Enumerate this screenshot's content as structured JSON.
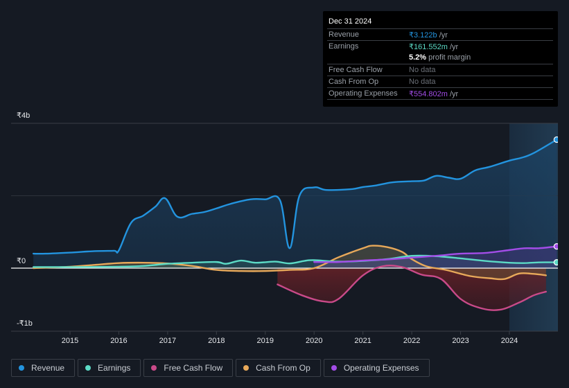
{
  "tooltip": {
    "date": "Dec 31 2024",
    "rows": [
      {
        "label": "Revenue",
        "value": "₹3.122b",
        "suffix": " /yr",
        "color": "#2394df"
      },
      {
        "label": "Earnings",
        "value": "₹161.552m",
        "suffix": " /yr",
        "color": "#5cdbc6"
      },
      {
        "label": "",
        "value": "5.2%",
        "suffix": " profit margin",
        "color": "#ffffff"
      },
      {
        "label": "Free Cash Flow",
        "value": "No data",
        "suffix": "",
        "color": "#6b7078"
      },
      {
        "label": "Cash From Op",
        "value": "No data",
        "suffix": "",
        "color": "#6b7078"
      },
      {
        "label": "Operating Expenses",
        "value": "₹554.802m",
        "suffix": " /yr",
        "color": "#a34de8"
      }
    ]
  },
  "legend": [
    {
      "label": "Revenue",
      "color": "#2394df"
    },
    {
      "label": "Earnings",
      "color": "#5cdbc6"
    },
    {
      "label": "Free Cash Flow",
      "color": "#c94a89"
    },
    {
      "label": "Cash From Op",
      "color": "#e8a95a"
    },
    {
      "label": "Operating Expenses",
      "color": "#a34de8"
    }
  ],
  "chart_data": {
    "type": "line",
    "title": "",
    "xlabel": "",
    "ylabel": "",
    "y_ticks": [
      "₹4b",
      "₹0",
      "-₹1b"
    ],
    "y_tick_values": [
      4,
      0,
      -1
    ],
    "ylim": [
      -1,
      4
    ],
    "xlim": [
      2014.2,
      2025.0
    ],
    "x_ticks": [
      "2015",
      "2016",
      "2017",
      "2018",
      "2019",
      "2020",
      "2021",
      "2022",
      "2023",
      "2024"
    ],
    "units": "₹ billions",
    "forecast_shade_start": 2024.0,
    "series": [
      {
        "name": "Revenue",
        "color": "#2394df",
        "points": [
          [
            2014.25,
            0.4
          ],
          [
            2014.5,
            0.4
          ],
          [
            2015.0,
            0.43
          ],
          [
            2015.5,
            0.47
          ],
          [
            2015.9,
            0.48
          ],
          [
            2016.0,
            0.49
          ],
          [
            2016.25,
            1.25
          ],
          [
            2016.5,
            1.45
          ],
          [
            2016.75,
            1.7
          ],
          [
            2016.95,
            1.93
          ],
          [
            2017.2,
            1.42
          ],
          [
            2017.5,
            1.5
          ],
          [
            2017.75,
            1.55
          ],
          [
            2018.0,
            1.65
          ],
          [
            2018.3,
            1.78
          ],
          [
            2018.7,
            1.9
          ],
          [
            2019.0,
            1.9
          ],
          [
            2019.3,
            1.88
          ],
          [
            2019.5,
            0.55
          ],
          [
            2019.7,
            2.0
          ],
          [
            2020.0,
            2.23
          ],
          [
            2020.25,
            2.16
          ],
          [
            2020.75,
            2.18
          ],
          [
            2021.0,
            2.24
          ],
          [
            2021.25,
            2.28
          ],
          [
            2021.6,
            2.37
          ],
          [
            2022.0,
            2.4
          ],
          [
            2022.25,
            2.42
          ],
          [
            2022.5,
            2.55
          ],
          [
            2022.75,
            2.5
          ],
          [
            2023.0,
            2.47
          ],
          [
            2023.3,
            2.7
          ],
          [
            2023.6,
            2.8
          ],
          [
            2024.0,
            2.97
          ],
          [
            2024.25,
            3.05
          ],
          [
            2024.5,
            3.18
          ],
          [
            2024.97,
            3.55
          ]
        ]
      },
      {
        "name": "Earnings",
        "color": "#5cdbc6",
        "points": [
          [
            2014.25,
            0.03
          ],
          [
            2015.0,
            0.03
          ],
          [
            2016.0,
            0.04
          ],
          [
            2016.5,
            0.06
          ],
          [
            2017.0,
            0.12
          ],
          [
            2017.5,
            0.15
          ],
          [
            2018.0,
            0.17
          ],
          [
            2018.2,
            0.12
          ],
          [
            2018.5,
            0.21
          ],
          [
            2018.8,
            0.15
          ],
          [
            2019.2,
            0.18
          ],
          [
            2019.5,
            0.13
          ],
          [
            2019.8,
            0.2
          ],
          [
            2020.0,
            0.22
          ],
          [
            2020.5,
            0.18
          ],
          [
            2021.0,
            0.2
          ],
          [
            2021.5,
            0.25
          ],
          [
            2022.0,
            0.34
          ],
          [
            2022.5,
            0.33
          ],
          [
            2023.0,
            0.27
          ],
          [
            2023.5,
            0.2
          ],
          [
            2024.0,
            0.15
          ],
          [
            2024.3,
            0.14
          ],
          [
            2024.6,
            0.16
          ],
          [
            2024.97,
            0.16
          ]
        ]
      },
      {
        "name": "Free Cash Flow",
        "color": "#c94a89",
        "points": [
          [
            2019.25,
            -0.45
          ],
          [
            2019.75,
            -0.75
          ],
          [
            2020.2,
            -0.92
          ],
          [
            2020.5,
            -0.85
          ],
          [
            2021.0,
            -0.2
          ],
          [
            2021.4,
            0.05
          ],
          [
            2021.8,
            0.03
          ],
          [
            2022.2,
            -0.18
          ],
          [
            2022.6,
            -0.3
          ],
          [
            2023.0,
            -0.85
          ],
          [
            2023.4,
            -1.1
          ],
          [
            2023.8,
            -1.15
          ],
          [
            2024.2,
            -0.95
          ],
          [
            2024.5,
            -0.75
          ],
          [
            2024.75,
            -0.65
          ]
        ]
      },
      {
        "name": "Cash From Op",
        "color": "#e8a95a",
        "points": [
          [
            2014.25,
            0.0
          ],
          [
            2015.0,
            0.04
          ],
          [
            2015.5,
            0.09
          ],
          [
            2016.0,
            0.14
          ],
          [
            2016.5,
            0.15
          ],
          [
            2017.0,
            0.13
          ],
          [
            2017.5,
            0.06
          ],
          [
            2018.0,
            -0.05
          ],
          [
            2018.5,
            -0.08
          ],
          [
            2019.0,
            -0.08
          ],
          [
            2019.5,
            -0.05
          ],
          [
            2020.0,
            0.0
          ],
          [
            2020.5,
            0.3
          ],
          [
            2021.0,
            0.55
          ],
          [
            2021.2,
            0.62
          ],
          [
            2021.5,
            0.58
          ],
          [
            2021.8,
            0.45
          ],
          [
            2022.0,
            0.25
          ],
          [
            2022.3,
            0.05
          ],
          [
            2022.7,
            -0.05
          ],
          [
            2023.2,
            -0.22
          ],
          [
            2023.6,
            -0.28
          ],
          [
            2023.9,
            -0.3
          ],
          [
            2024.2,
            -0.15
          ],
          [
            2024.5,
            -0.16
          ],
          [
            2024.75,
            -0.2
          ]
        ]
      },
      {
        "name": "Operating Expenses",
        "color": "#a34de8",
        "points": [
          [
            2020.0,
            0.17
          ],
          [
            2020.5,
            0.17
          ],
          [
            2021.0,
            0.21
          ],
          [
            2021.5,
            0.24
          ],
          [
            2022.0,
            0.29
          ],
          [
            2022.5,
            0.34
          ],
          [
            2023.0,
            0.4
          ],
          [
            2023.5,
            0.42
          ],
          [
            2024.0,
            0.5
          ],
          [
            2024.3,
            0.55
          ],
          [
            2024.6,
            0.55
          ],
          [
            2024.97,
            0.6
          ]
        ]
      }
    ]
  }
}
